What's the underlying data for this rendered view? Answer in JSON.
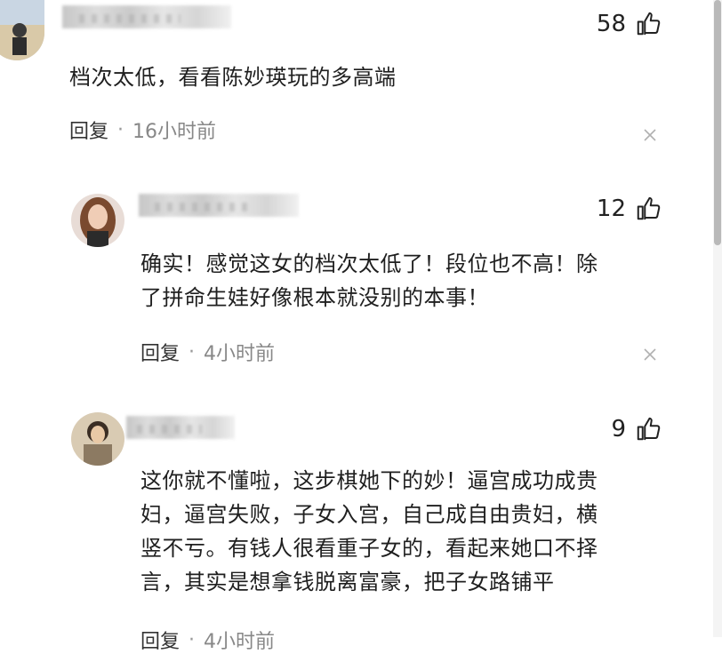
{
  "comments": [
    {
      "likes": "58",
      "text": "档次太低，看看陈妙瑛玩的多高端",
      "reply_label": "回复",
      "separator": "·",
      "time": "16小时前"
    },
    {
      "likes": "12",
      "text_lines": [
        "确实！感觉这女的档次太低了！段位也不高！除",
        "了拼命生娃好像根本就没别的本事！"
      ],
      "reply_label": "回复",
      "separator": "·",
      "time": "4小时前"
    },
    {
      "likes": "9",
      "text_lines": [
        "这你就不懂啦，这步棋她下的妙！逼宫成功成贵",
        "妇，逼宫失败，子女入宫，自己成自由贵妇，横",
        "竖不亏。有钱人很看重子女的，看起来她口不择",
        "言，其实是想拿钱脱离富豪，把子女路铺平"
      ],
      "reply_label": "回复",
      "separator": "·",
      "time": "4小时前"
    }
  ],
  "icons": {
    "like": "thumbs-up-icon",
    "close": "close-icon"
  },
  "colors": {
    "text": "#1f1f1f",
    "meta": "#888888",
    "background": "#ffffff"
  }
}
